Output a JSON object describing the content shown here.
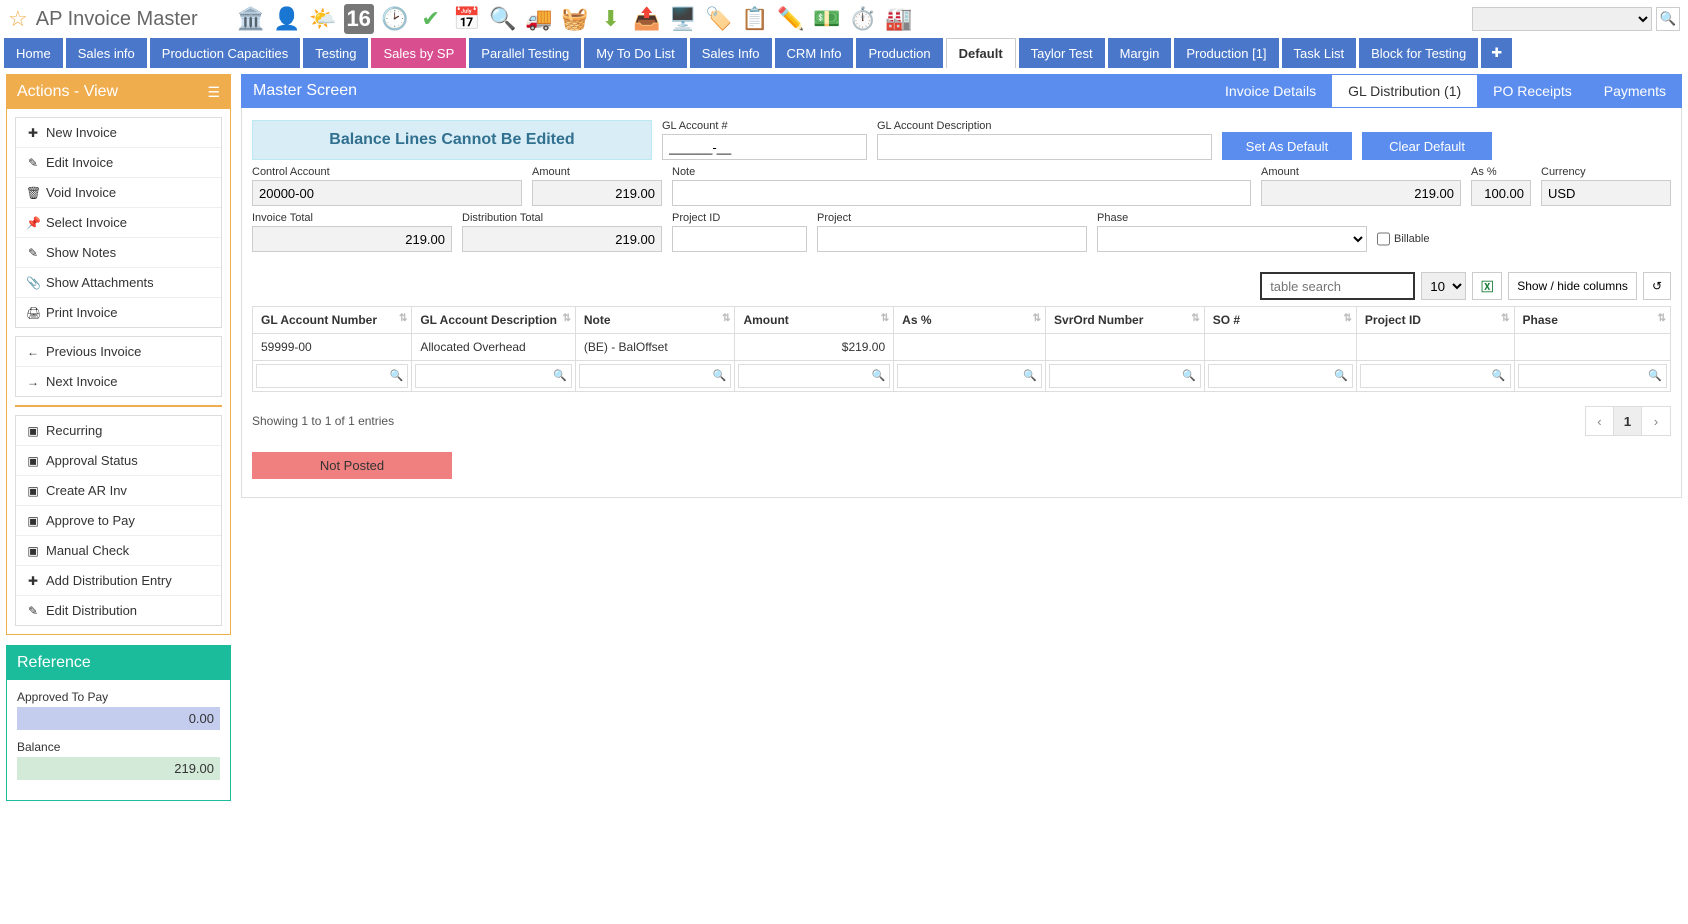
{
  "header": {
    "title": "AP Invoice Master"
  },
  "nav": [
    {
      "label": "Home"
    },
    {
      "label": "Sales info"
    },
    {
      "label": "Production Capacities"
    },
    {
      "label": "Testing"
    },
    {
      "label": "Sales by SP",
      "pink": true
    },
    {
      "label": "Parallel Testing"
    },
    {
      "label": "My To Do List"
    },
    {
      "label": "Sales Info"
    },
    {
      "label": "CRM Info"
    },
    {
      "label": "Production"
    },
    {
      "label": "Default",
      "active": true
    },
    {
      "label": "Taylor Test"
    },
    {
      "label": "Margin"
    },
    {
      "label": "Production [1]"
    },
    {
      "label": "Task List"
    },
    {
      "label": "Block for Testing"
    }
  ],
  "actions": {
    "title": "Actions - View",
    "group1": [
      "New Invoice",
      "Edit Invoice",
      "Void Invoice",
      "Select Invoice",
      "Show Notes",
      "Show Attachments",
      "Print Invoice"
    ],
    "group2": [
      "Previous Invoice",
      "Next Invoice"
    ],
    "group3": [
      "Recurring",
      "Approval Status",
      "Create AR Inv",
      "Approve to Pay",
      "Manual Check",
      "Add Distribution Entry",
      "Edit Distribution"
    ],
    "icons1": [
      "✚",
      "✎",
      "🗑",
      "📌",
      "✎",
      "📎",
      "🖨"
    ],
    "icons2": [
      "←",
      "→"
    ],
    "icons3": [
      "▣",
      "▣",
      "▣",
      "▣",
      "▣",
      "✚",
      "✎"
    ]
  },
  "reference": {
    "title": "Reference",
    "approved_label": "Approved To Pay",
    "approved_value": "0.00",
    "balance_label": "Balance",
    "balance_value": "219.00"
  },
  "master": {
    "title": "Master Screen",
    "tabs": [
      "Invoice Details",
      "GL Distribution (1)",
      "PO Receipts",
      "Payments"
    ],
    "active_tab": 1,
    "banner": "Balance Lines Cannot Be Edited",
    "labels": {
      "gl_account_no": "GL Account #",
      "gl_account_desc": "GL Account Description",
      "control_account": "Control Account",
      "amount": "Amount",
      "note": "Note",
      "as_pct": "As %",
      "currency": "Currency",
      "invoice_total": "Invoice Total",
      "distribution_total": "Distribution Total",
      "project_id": "Project ID",
      "project": "Project",
      "phase": "Phase",
      "billable": "Billable"
    },
    "buttons": {
      "set_default": "Set As Default",
      "clear_default": "Clear Default"
    },
    "values": {
      "gl_account_no": "______-__",
      "control_account": "20000-00",
      "amount1": "219.00",
      "amount2": "219.00",
      "as_pct": "100.00",
      "currency": "USD",
      "invoice_total": "219.00",
      "distribution_total": "219.00"
    },
    "table": {
      "search_placeholder": "table search",
      "page_size": "10",
      "show_cols": "Show / hide columns",
      "headers": [
        "GL Account Number",
        "GL Account Description",
        "Note",
        "Amount",
        "As %",
        "SvrOrd Number",
        "SO #",
        "Project ID",
        "Phase"
      ],
      "rows": [
        {
          "gl": "59999-00",
          "desc": "Allocated Overhead",
          "note": "(BE) - BalOffset",
          "amount": "$219.00",
          "aspct": "",
          "svrord": "",
          "so": "",
          "proj": "",
          "phase": ""
        }
      ],
      "footer": "Showing 1 to 1 of 1 entries",
      "page": "1"
    },
    "status": "Not Posted"
  }
}
